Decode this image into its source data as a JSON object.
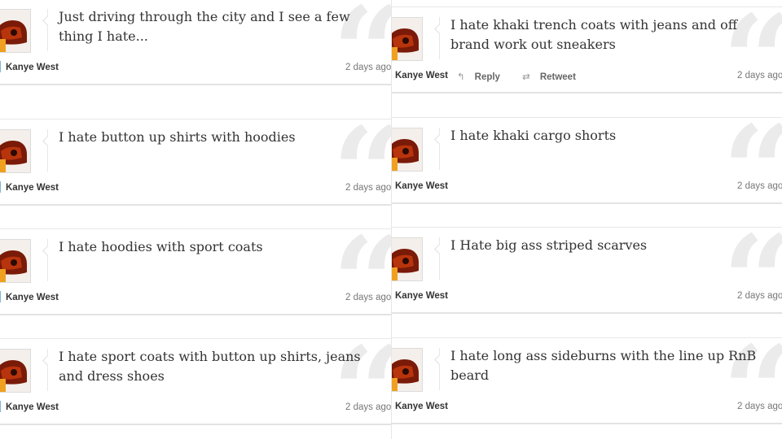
{
  "left_column": {
    "tweets": [
      {
        "text": "Just driving through the city and I see a few thing I hate...",
        "author": "Kanye West",
        "time": "2 days ago"
      },
      {
        "text": "I hate button up shirts with hoodies",
        "author": "Kanye West",
        "time": "2 days ago"
      },
      {
        "text": "I hate hoodies with sport coats",
        "author": "Kanye West",
        "time": "2 days ago"
      },
      {
        "text": "I hate sport coats with button up shirts, jeans and dress shoes",
        "author": "Kanye West",
        "time": "2 days ago"
      }
    ]
  },
  "right_column": {
    "tweets": [
      {
        "text": "I hate khaki trench coats with jeans and off brand work out sneakers",
        "author": "Kanye West",
        "time": "2 days ago",
        "reply_label": "Reply",
        "retweet_label": "Retweet"
      },
      {
        "text": "I hate khaki cargo shorts",
        "author": "Kanye West",
        "time": "2 days ago"
      },
      {
        "text": "I Hate big ass striped scarves",
        "author": "Kanye West",
        "time": "2 days ago"
      },
      {
        "text": "I hate long ass sideburns with the line up RnB beard",
        "author": "Kanye West",
        "time": "2 days ago"
      }
    ]
  },
  "icons": {
    "avatar": "profile-photo",
    "quote": "quote-mark-icon",
    "reply": "reply-arrow-icon",
    "retweet": "retweet-icon"
  },
  "colors": {
    "text": "#333333",
    "quote_mark": "#ebebeb",
    "border": "#e3e3e3",
    "author_accent": "#7fb6d8"
  }
}
